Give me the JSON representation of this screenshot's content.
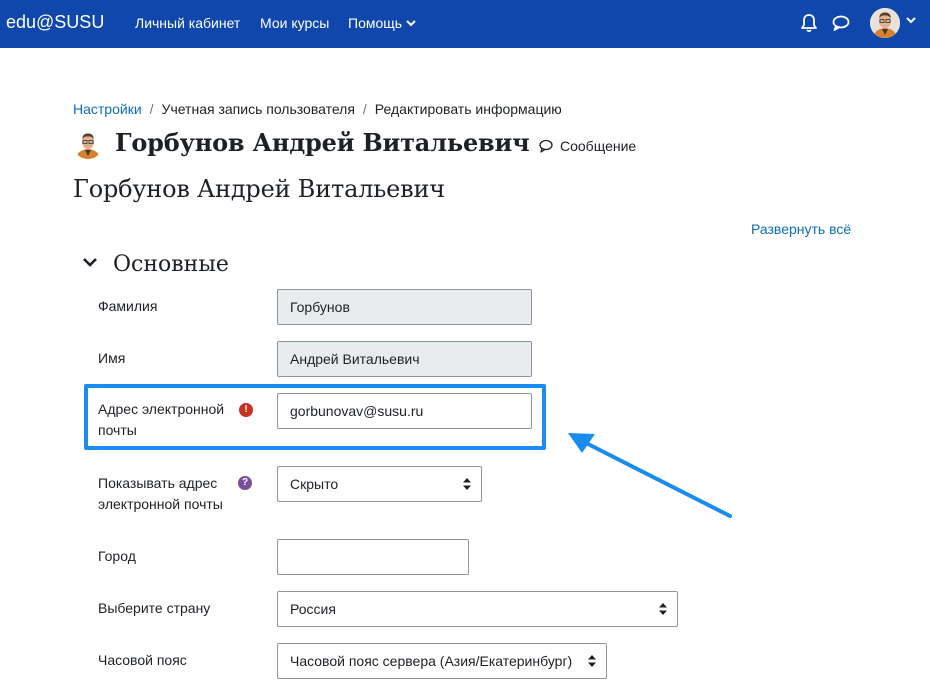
{
  "navbar": {
    "brand": "edu@SUSU",
    "links": [
      "Личный кабинет",
      "Мои курсы",
      "Помощь"
    ],
    "icons": [
      "bell-icon",
      "chat-bubble-icon"
    ],
    "bg_color": "#0f47ad"
  },
  "breadcrumb": {
    "items": [
      "Настройки",
      "Учетная запись пользователя",
      "Редактировать информацию"
    ]
  },
  "header": {
    "user_name": "Горбунов Андрей Витальевич",
    "message_label": "Сообщение",
    "page_heading": "Горбунов Андрей Витальевич"
  },
  "expand_all": "Развернуть всё",
  "section": {
    "title": "Основные"
  },
  "form": {
    "lastname": {
      "label": "Фамилия",
      "value": "Горбунов"
    },
    "firstname": {
      "label": "Имя",
      "value": "Андрей Витальевич"
    },
    "email": {
      "label_line1": "Адрес электронной",
      "label_line2": "почты",
      "value": "gorbunovav@susu.ru",
      "required": true
    },
    "maildisplay": {
      "label_line1": "Показывать адрес",
      "label_line2": "электронной почты",
      "value": "Скрыто"
    },
    "city": {
      "label": "Город",
      "value": ""
    },
    "country": {
      "label": "Выберите страну",
      "value": "Россия"
    },
    "timezone": {
      "label": "Часовой пояс",
      "value": "Часовой пояс сервера (Азия/Екатеринбург)"
    }
  },
  "annotation": {
    "highlight_color": "#1a8cf0"
  }
}
